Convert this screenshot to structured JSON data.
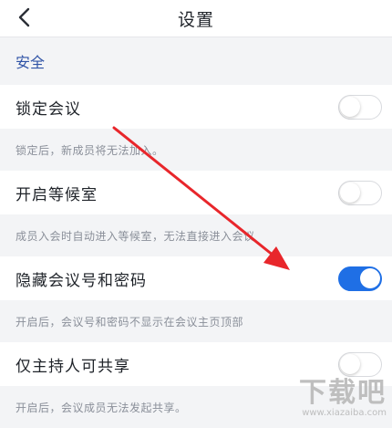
{
  "header": {
    "title": "设置"
  },
  "section": {
    "title": "安全"
  },
  "settings": [
    {
      "label": "锁定会议",
      "description": "锁定后，新成员将无法加入。",
      "enabled": false
    },
    {
      "label": "开启等候室",
      "description": "成员入会时自动进入等候室，无法直接进入会议",
      "enabled": false
    },
    {
      "label": "隐藏会议号和密码",
      "description": "开启后，会议号和密码不显示在会议主页顶部",
      "enabled": true
    },
    {
      "label": "仅主持人可共享",
      "description": "开启后，会议成员无法发起共享。",
      "enabled": false
    }
  ],
  "colors": {
    "accent": "#1f6fe5",
    "annotation_arrow": "#e8262b",
    "section_title": "#2f53a6"
  },
  "watermark": {
    "text": "下载吧",
    "url": "www.xiazaiba.com"
  }
}
